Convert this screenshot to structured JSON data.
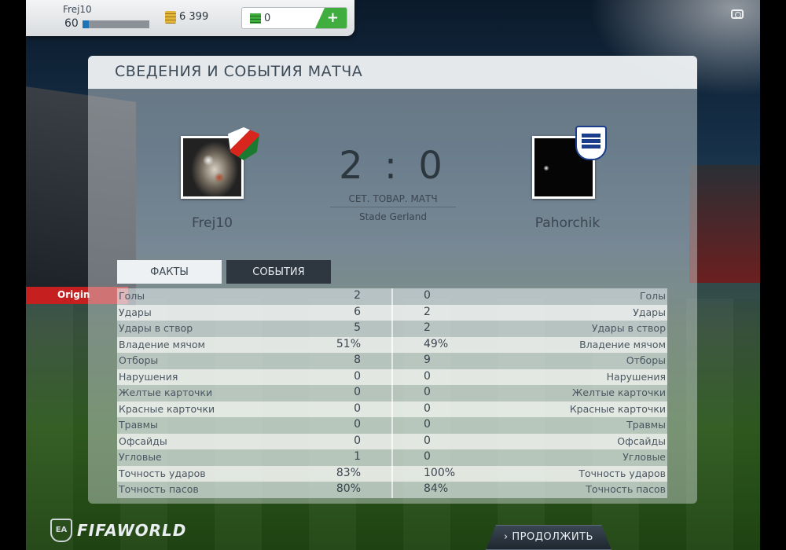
{
  "user": {
    "name": "Frej10",
    "level": "60",
    "xp_progress": 0.09,
    "coins": "6 399",
    "points": "0",
    "points_add": "+"
  },
  "panel": {
    "title": "СВЕДЕНИЯ И СОБЫТИЯ МАТЧА"
  },
  "match": {
    "home_team": "Frej10",
    "away_team": "Pahorchik",
    "score": "2 : 0",
    "match_type": "СЕТ. ТОВАР. МАТЧ",
    "stadium": "Stade Gerland"
  },
  "tabs": {
    "facts": "ФАКТЫ",
    "events": "СОБЫТИЯ"
  },
  "stats": [
    {
      "label": "Голы",
      "home": "2",
      "away": "0"
    },
    {
      "label": "Удары",
      "home": "6",
      "away": "2"
    },
    {
      "label": "Удары в створ",
      "home": "5",
      "away": "2"
    },
    {
      "label": "Владение мячом",
      "home": "51%",
      "away": "49%"
    },
    {
      "label": "Отборы",
      "home": "8",
      "away": "9"
    },
    {
      "label": "Нарушения",
      "home": "0",
      "away": "0"
    },
    {
      "label": "Желтые карточки",
      "home": "0",
      "away": "0"
    },
    {
      "label": "Красные карточки",
      "home": "0",
      "away": "0"
    },
    {
      "label": "Травмы",
      "home": "0",
      "away": "0"
    },
    {
      "label": "Офсайды",
      "home": "0",
      "away": "0"
    },
    {
      "label": "Угловые",
      "home": "1",
      "away": "0"
    },
    {
      "label": "Точность ударов",
      "home": "83%",
      "away": "100%"
    },
    {
      "label": "Точность пасов",
      "home": "80%",
      "away": "84%"
    }
  ],
  "background": {
    "ad_board": "Origin"
  },
  "footer": {
    "brand_mark": "EA",
    "brand": "FIFAWORLD",
    "continue_label": "› ПРОДОЛЖИТЬ"
  },
  "colors": {
    "accent_green": "#3fae3f",
    "tab_active": "#2e3640",
    "xp_blue": "#1f73b7"
  }
}
